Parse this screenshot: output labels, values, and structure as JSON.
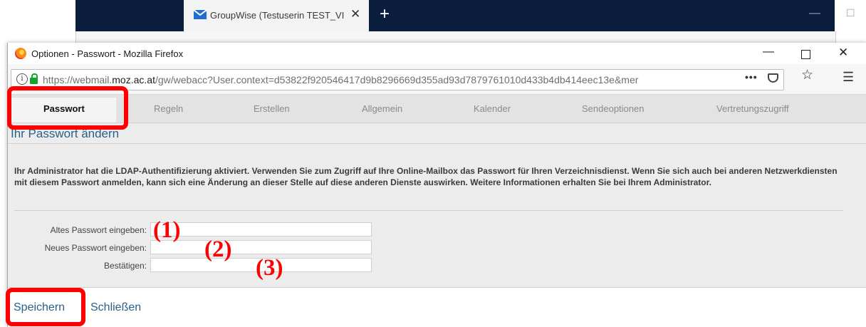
{
  "background_window": {
    "tab_title": "GroupWise (Testuserin TEST_VI",
    "new_tab_label": "+"
  },
  "window": {
    "title": "Optionen - Passwort - Mozilla Firefox"
  },
  "url": {
    "prefix": "https://webmail.",
    "domain": "moz.ac.at",
    "path": "/gw/webacc?User.context=d53822f920546417d9b8296669d355ad93d7879761010d433b4db414eec13e&mer"
  },
  "tabs": [
    "Passwort",
    "Regeln",
    "Erstellen",
    "Allgemein",
    "Kalender",
    "Sendeoptionen",
    "Vertretungszugriff"
  ],
  "section_title": "Ihr Passwort ändern",
  "info_text": "Ihr Administrator hat die LDAP-Authentifizierung aktiviert. Verwenden Sie zum Zugriff auf Ihre Online-Mailbox das Passwort für Ihren Verzeichnisdienst. Wenn Sie sich auch bei anderen Netzwerkdiensten mit diesem Passwort anmelden, kann sich eine Änderung an dieser Stelle auf diese anderen Dienste auswirken. Weitere Informationen erhalten Sie bei Ihrem Administrator.",
  "fields": [
    {
      "label": "Altes Passwort eingeben:",
      "value": ""
    },
    {
      "label": "Neues Passwort eingeben:",
      "value": ""
    },
    {
      "label": "Bestätigen:",
      "value": ""
    }
  ],
  "footer": {
    "save_label": "Speichern",
    "close_label": "Schließen"
  },
  "annotations": [
    "(1)",
    "(2)",
    "(3)"
  ],
  "colors": {
    "accent": "#2c5f8a",
    "highlight": "#ff0000",
    "titlebar_dark": "#0b1d3c"
  }
}
